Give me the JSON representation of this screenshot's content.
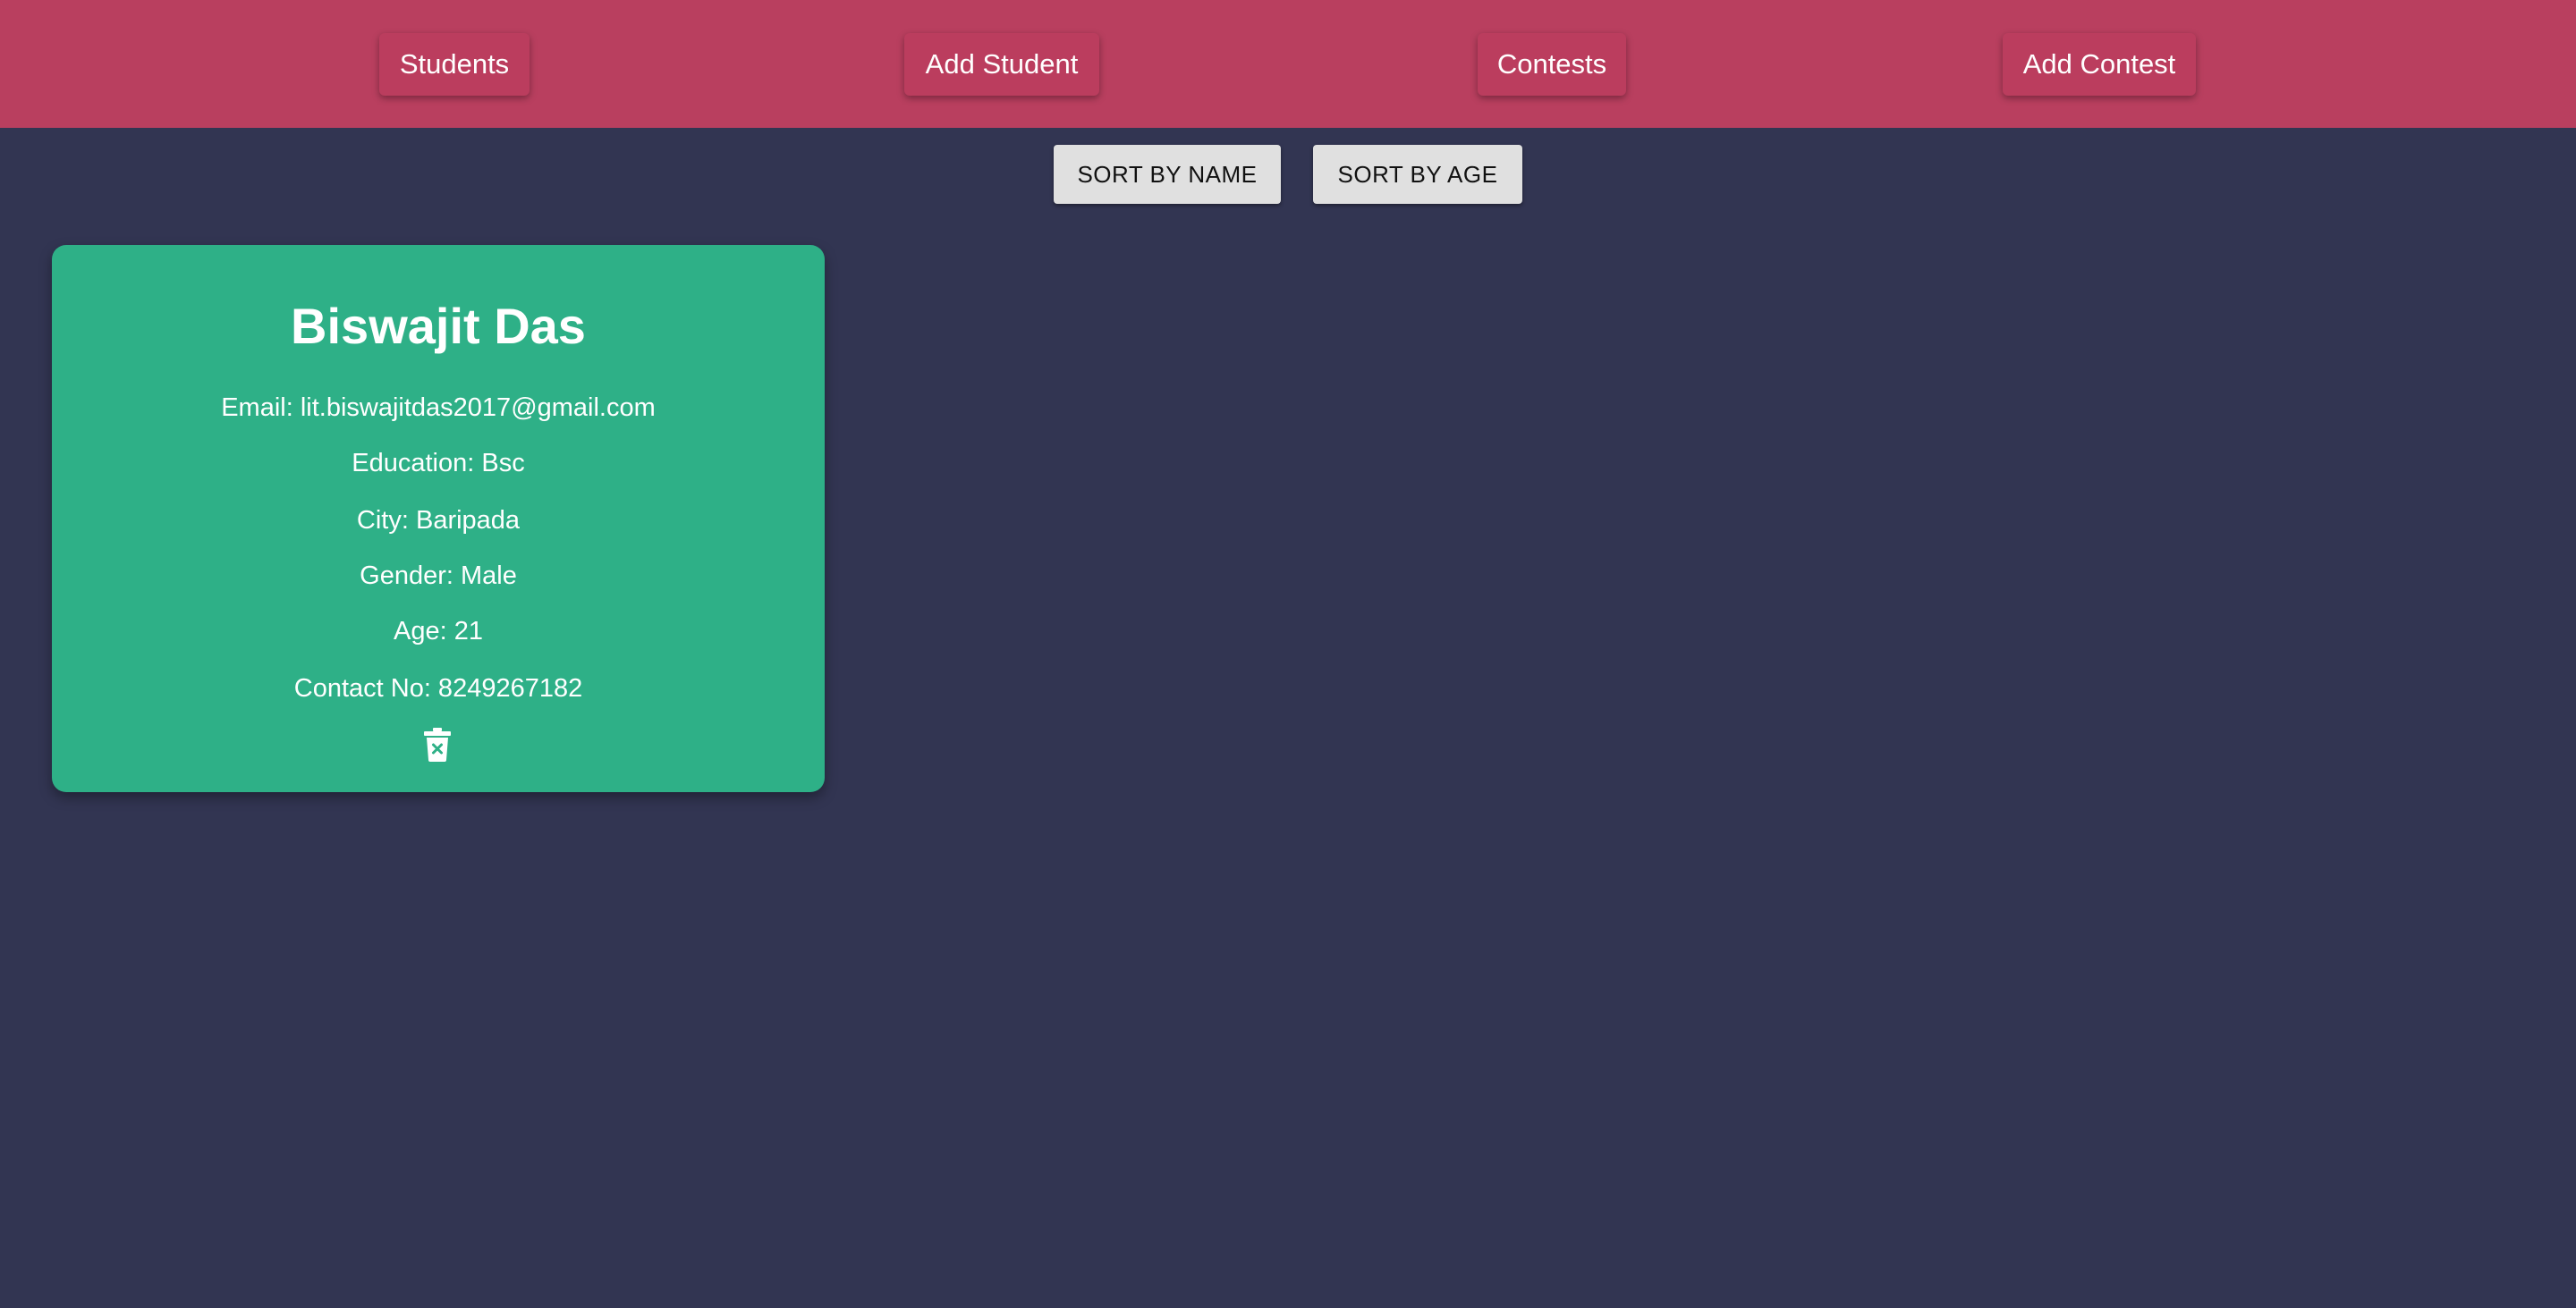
{
  "nav": {
    "students": "Students",
    "add_student": "Add Student",
    "contests": "Contests",
    "add_contest": "Add Contest"
  },
  "sort": {
    "by_name": "SORT BY NAME",
    "by_age": "SORT BY AGE"
  },
  "student_card": {
    "name": "Biswajit Das",
    "email": "Email: lit.biswajitdas2017@gmail.com",
    "education": "Education: Bsc",
    "city": "City: Baripada",
    "gender": "Gender: Male",
    "age": "Age: 21",
    "contact": "Contact No: 8249267182",
    "delete_icon": "trash-x-icon"
  },
  "colors": {
    "background": "#323552",
    "navbar": "#b93f5f",
    "card": "#2eb087",
    "sort_button": "#e0e0e0"
  }
}
